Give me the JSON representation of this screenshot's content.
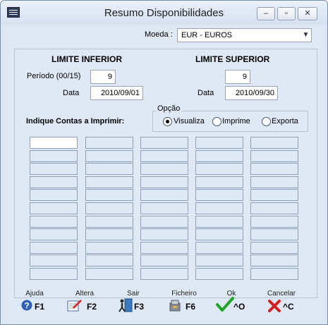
{
  "window": {
    "title": "Resumo Disponibilidades"
  },
  "moeda": {
    "label": "Moeda :",
    "value": "EUR - EUROS"
  },
  "inferior": {
    "heading": "LIMITE INFERIOR",
    "periodo_label": "Período (00/15)",
    "periodo": "9",
    "data_label": "Data",
    "data": "2010/09/01"
  },
  "superior": {
    "heading": "LIMITE SUPERIOR",
    "periodo": "9",
    "data_label": "Data",
    "data": "2010/09/30"
  },
  "contas_label": "Indique Contas a Imprimir:",
  "opcao": {
    "title": "Opção",
    "options": [
      "Visualiza",
      "Imprime",
      "Exporta"
    ],
    "selected": "Visualiza"
  },
  "grid": {
    "columns": 5,
    "rows": 11
  },
  "fkeys": [
    {
      "caption": "Ajuda",
      "key": "F1",
      "icon": "help-icon"
    },
    {
      "caption": "Altera",
      "key": "F2",
      "icon": "edit-icon"
    },
    {
      "caption": "Sair",
      "key": "F3",
      "icon": "exit-icon"
    },
    {
      "caption": "Ficheiro",
      "key": "F6",
      "icon": "file-icon"
    },
    {
      "caption": "Ok",
      "key": "^O",
      "icon": "checkmark-icon"
    },
    {
      "caption": "Cancelar",
      "key": "^C",
      "icon": "cancel-icon"
    }
  ]
}
